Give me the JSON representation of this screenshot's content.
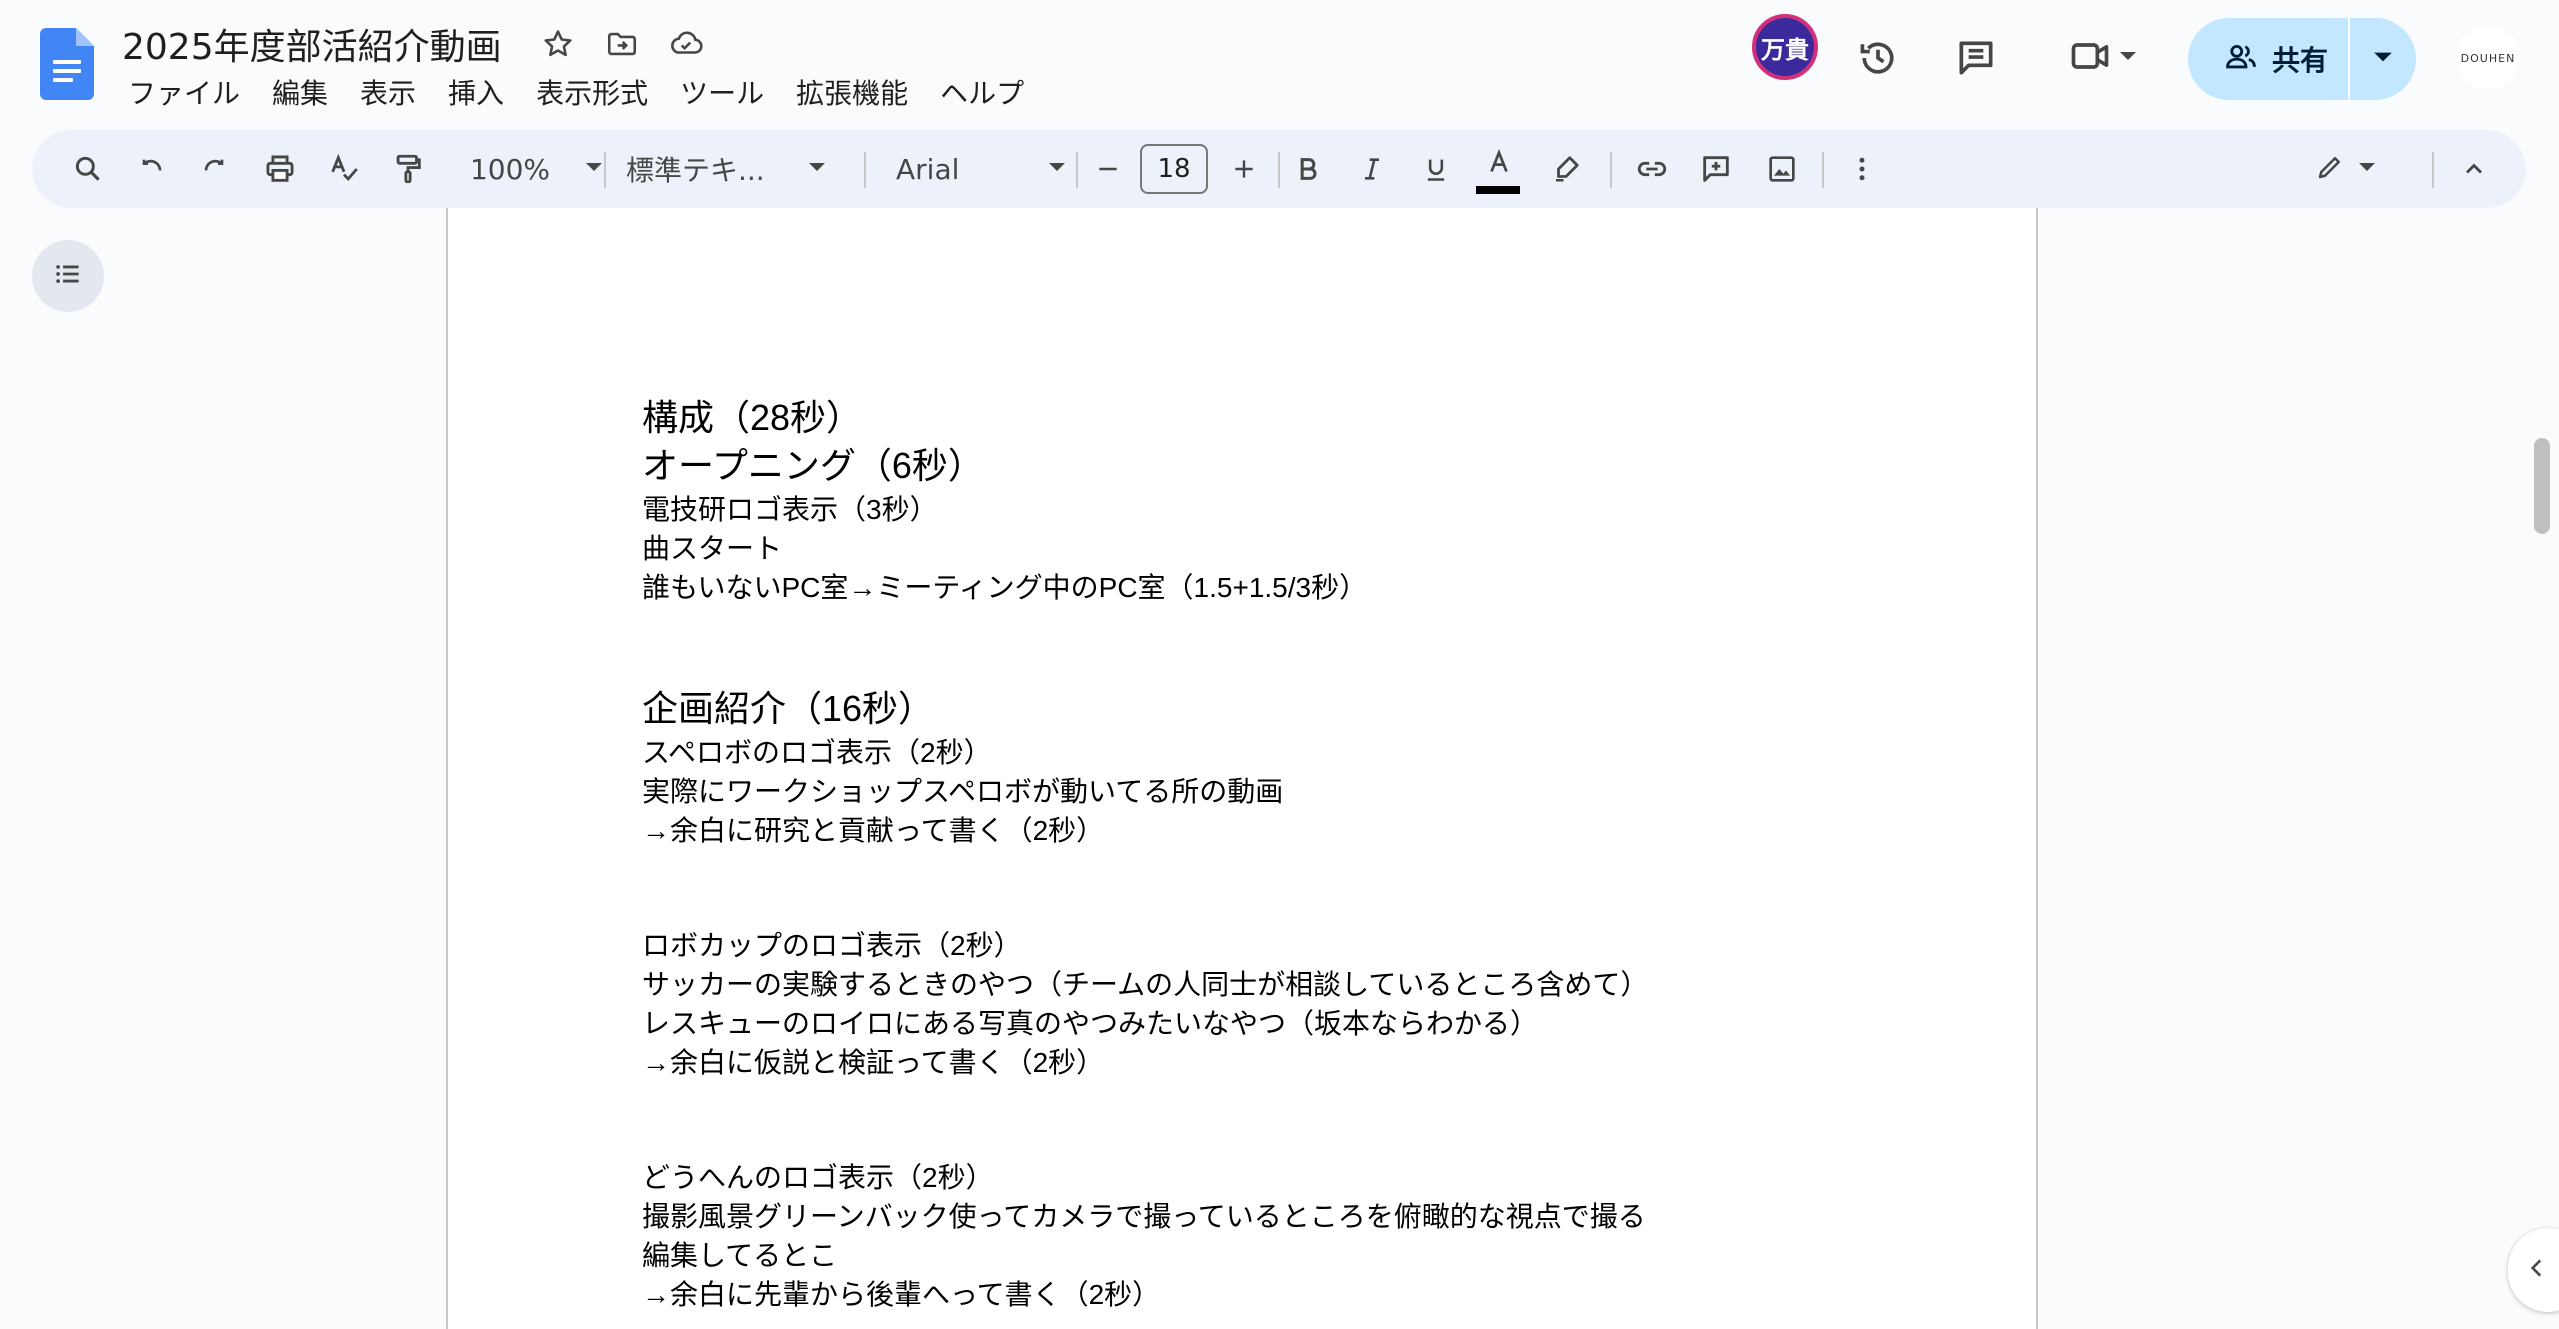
{
  "header": {
    "doc_title": "2025年度部活紹介動画",
    "menu": [
      "ファイル",
      "編集",
      "表示",
      "挿入",
      "表示形式",
      "ツール",
      "拡張機能",
      "ヘルプ"
    ],
    "avatar_text": "万貴",
    "share_label": "共有",
    "account_label": "DOUHEN"
  },
  "toolbar": {
    "zoom": "100%",
    "style": "標準テキ...",
    "font": "Arial",
    "font_size": "18"
  },
  "document": {
    "lines": [
      "構成（28秒）",
      "オープニング（6秒）",
      "電技研ロゴ表示（3秒）",
      "曲スタート",
      "誰もいないPC室→ミーティング中のPC室（1.5+1.5/3秒）",
      "企画紹介（16秒）",
      "スペロボのロゴ表示（2秒）",
      "実際にワークショップスペロボが動いてる所の動画",
      "→余白に研究と貢献って書く（2秒）",
      "ロボカップのロゴ表示（2秒）",
      "サッカーの実験するときのやつ（チームの人同士が相談しているところ含めて）",
      "レスキューのロイロにある写真のやつみたいなやつ（坂本ならわかる）",
      "→余白に仮説と検証って書く（2秒）",
      "どうへんのロゴ表示（2秒）",
      "撮影風景グリーンバック使ってカメラで撮っているところを俯瞰的な視点で撮る",
      "編集してるとこ",
      "→余白に先輩から後輩へって書く（2秒）"
    ]
  },
  "colors": {
    "toolbar_bg": "#edf2fa",
    "share_bg": "#c2e7ff",
    "docs_blue": "#4285f4",
    "avatar_bg": "#3b2a9c",
    "avatar_ring": "#d1307a"
  }
}
